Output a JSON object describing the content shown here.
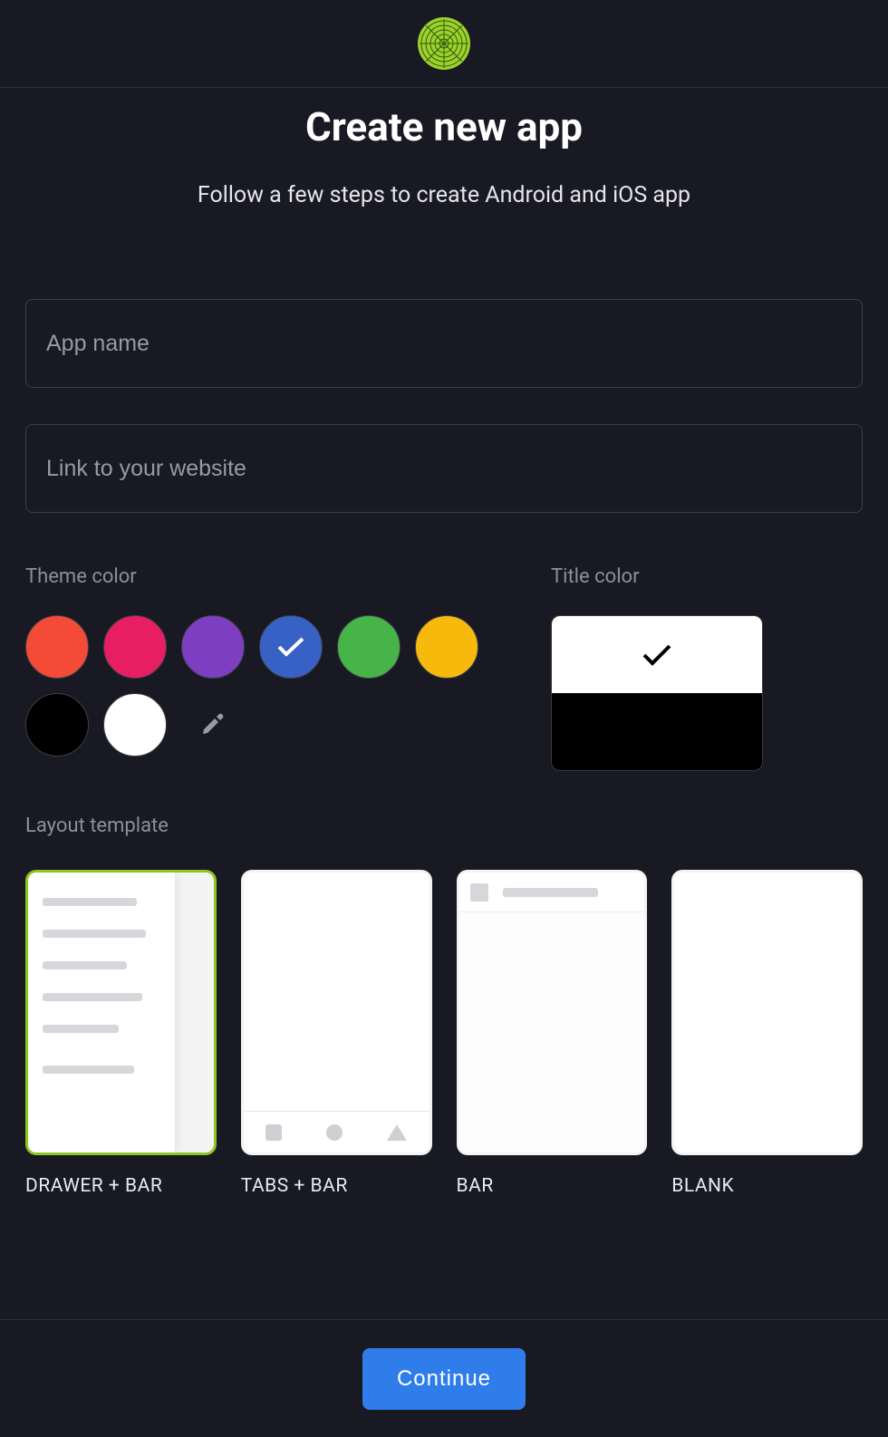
{
  "page": {
    "title": "Create new app",
    "subtitle": "Follow a few steps to create Android and iOS app"
  },
  "form": {
    "app_name_placeholder": "App name",
    "app_name_value": "",
    "website_placeholder": "Link to your website",
    "website_value": ""
  },
  "sections": {
    "theme_label": "Theme color",
    "title_color_label": "Title color",
    "layout_label": "Layout template"
  },
  "theme_colors": [
    {
      "name": "red",
      "hex": "#f34b36",
      "selected": false
    },
    {
      "name": "pink",
      "hex": "#e71e62",
      "selected": false
    },
    {
      "name": "purple",
      "hex": "#7e3ec2",
      "selected": false
    },
    {
      "name": "blue",
      "hex": "#3861c6",
      "selected": true
    },
    {
      "name": "green",
      "hex": "#47b449",
      "selected": false
    },
    {
      "name": "yellow",
      "hex": "#f8b90d",
      "selected": false
    },
    {
      "name": "black",
      "hex": "#000000",
      "selected": false
    },
    {
      "name": "white",
      "hex": "#ffffff",
      "selected": false
    }
  ],
  "title_colors": {
    "white_selected": true,
    "black_selected": false
  },
  "templates": [
    {
      "id": "drawer_bar",
      "label": "DRAWER + BAR",
      "selected": true
    },
    {
      "id": "tabs_bar",
      "label": "TABS + BAR",
      "selected": false
    },
    {
      "id": "bar",
      "label": "BAR",
      "selected": false
    },
    {
      "id": "blank",
      "label": "BLANK",
      "selected": false
    }
  ],
  "actions": {
    "continue_label": "Continue"
  }
}
